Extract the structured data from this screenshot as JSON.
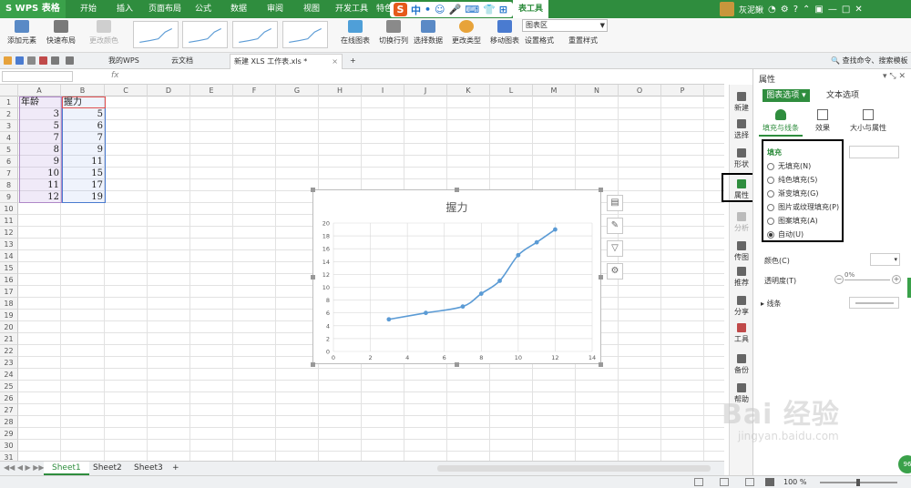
{
  "menubar": {
    "app_name": "S WPS 表格",
    "items": [
      "开始",
      "插入",
      "页面布局",
      "公式",
      "数据",
      "审阅",
      "视图",
      "开发工具",
      "特色"
    ],
    "active_tab": "表工具",
    "ime": [
      "S",
      "中",
      "•",
      "☺",
      "🎤",
      "⌨",
      "👕",
      "⊞"
    ],
    "user_name": "灰泥鳅"
  },
  "ribbon": {
    "add_element": "添加元素",
    "quick_layout": "快速布局",
    "change_color": "更改颜色",
    "online_chart": "在线图表",
    "switch_row_col": "切换行列",
    "select_data": "选择数据",
    "change_type": "更改类型",
    "move_chart": "移动图表",
    "set_format": "设置格式",
    "reset_style": "重置样式",
    "chart_area": "图表区"
  },
  "tabbar": {
    "tabs": [
      "我的WPS",
      "云文档",
      "新建 XLS 工作表.xls *"
    ],
    "search": "查找命令、搜索模板"
  },
  "formula": {
    "fx": "fx"
  },
  "grid": {
    "columns": [
      "A",
      "B",
      "C",
      "D",
      "E",
      "F",
      "G",
      "H",
      "I",
      "J",
      "K",
      "L",
      "M",
      "N",
      "O",
      "P"
    ],
    "rows": [
      "1",
      "2",
      "3",
      "4",
      "5",
      "6",
      "7",
      "8",
      "9",
      "10",
      "11",
      "12",
      "13",
      "14",
      "15",
      "16",
      "17",
      "18",
      "19",
      "20",
      "21",
      "22",
      "23",
      "24",
      "25",
      "26",
      "27",
      "28",
      "29",
      "30",
      "31"
    ],
    "header_a": "年龄",
    "header_b": "握力",
    "data": [
      [
        "3",
        "5"
      ],
      [
        "5",
        "6"
      ],
      [
        "7",
        "7"
      ],
      [
        "8",
        "9"
      ],
      [
        "9",
        "11"
      ],
      [
        "10",
        "15"
      ],
      [
        "11",
        "17"
      ],
      [
        "12",
        "19"
      ]
    ]
  },
  "chart_data": {
    "type": "scatter",
    "title": "握力",
    "x": [
      3,
      5,
      7,
      8,
      9,
      10,
      11,
      12
    ],
    "y": [
      5,
      6,
      7,
      9,
      11,
      15,
      17,
      19
    ],
    "xlim": [
      0,
      14
    ],
    "ylim": [
      0,
      20
    ],
    "xticks": [
      "0",
      "2",
      "4",
      "6",
      "8",
      "10",
      "12",
      "14"
    ],
    "yticks": [
      "0",
      "2",
      "4",
      "6",
      "8",
      "10",
      "12",
      "14",
      "16",
      "18",
      "20"
    ],
    "smooth_line": true,
    "grid": true,
    "line_color": "#5b9bd5"
  },
  "sheets": {
    "tabs": [
      "Sheet1",
      "Sheet2",
      "Sheet3"
    ],
    "add": "+"
  },
  "status": {
    "zoom": "100 %"
  },
  "vtoolbar": {
    "items": [
      "新建",
      "选择",
      "形状",
      "属性",
      "分析",
      "传图",
      "推荐",
      "分享",
      "工具",
      "备份",
      "帮助"
    ]
  },
  "panel": {
    "title": "属性",
    "tab_chart": "图表选项",
    "tab_text": "文本选项",
    "sub_fill": "填充与线条",
    "sub_effect": "效果",
    "sub_size": "大小与属性",
    "fill_head": "填充",
    "fill_options": [
      "无填充(N)",
      "纯色填充(S)",
      "渐变填充(G)",
      "图片或纹理填充(P)",
      "图案填充(A)",
      "自动(U)"
    ],
    "fill_selected": 5,
    "color_label": "颜色(C)",
    "transparency_label": "透明度(T)",
    "transparency_value": "0%",
    "line_label": "线条"
  },
  "watermark": {
    "text": "Bai 经验",
    "sub": "jingyan.baidu.com"
  },
  "colors": {
    "accent": "#2f8d3e"
  }
}
